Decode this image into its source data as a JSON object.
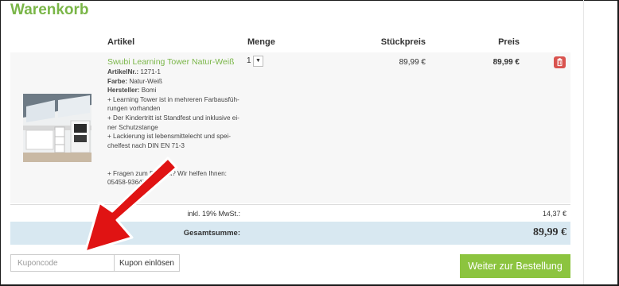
{
  "page": {
    "title": "Warenkorb"
  },
  "table": {
    "headers": {
      "article": "Artikel",
      "quantity": "Menge",
      "unit_price": "Stückpreis",
      "price": "Preis"
    }
  },
  "item": {
    "name": "Swubi Learning Tower Natur-Weiß",
    "article_no_label": "ArtikelNr.:",
    "article_no": "1271-1",
    "color_label": "Farbe:",
    "color": "Natur-Weiß",
    "maker_label": "Hersteller:",
    "maker": "Bomi",
    "desc_lines": [
      "+ Learning Tower ist in mehreren Farbausfüh-",
      "rungen vorhanden",
      "+ Der Kindertritt ist Standfest und inklusive ei-",
      "ner Schutzstange",
      "+ Lackierung ist lebensmittelecht und spei-",
      "chelfest nach DIN EN 71-3"
    ],
    "help_lines": [
      "+ Fragen zum Produkt? Wir helfen Ihnen:",
      "05458-936478"
    ],
    "quantity": "1",
    "qty_dropdown_icon": "caret-down-icon",
    "unit_price": "89,99 €",
    "line_total": "89,99 €",
    "delete_icon": "trash-icon"
  },
  "summary": {
    "tax_label": "inkl. 19% MwSt.:",
    "tax_value": "14,37 €",
    "total_label": "Gesamtsumme:",
    "total_value": "89,99 €"
  },
  "coupon": {
    "placeholder": "Kuponcode",
    "button_label": "Kupon einlösen"
  },
  "checkout": {
    "label": "Weiter zur Bestellung"
  },
  "colors": {
    "accent_green": "#7ab648",
    "button_green": "#8cc43f",
    "total_band": "#d8e8f1",
    "delete_red": "#d9534f",
    "annotation_arrow": "#e01313"
  }
}
